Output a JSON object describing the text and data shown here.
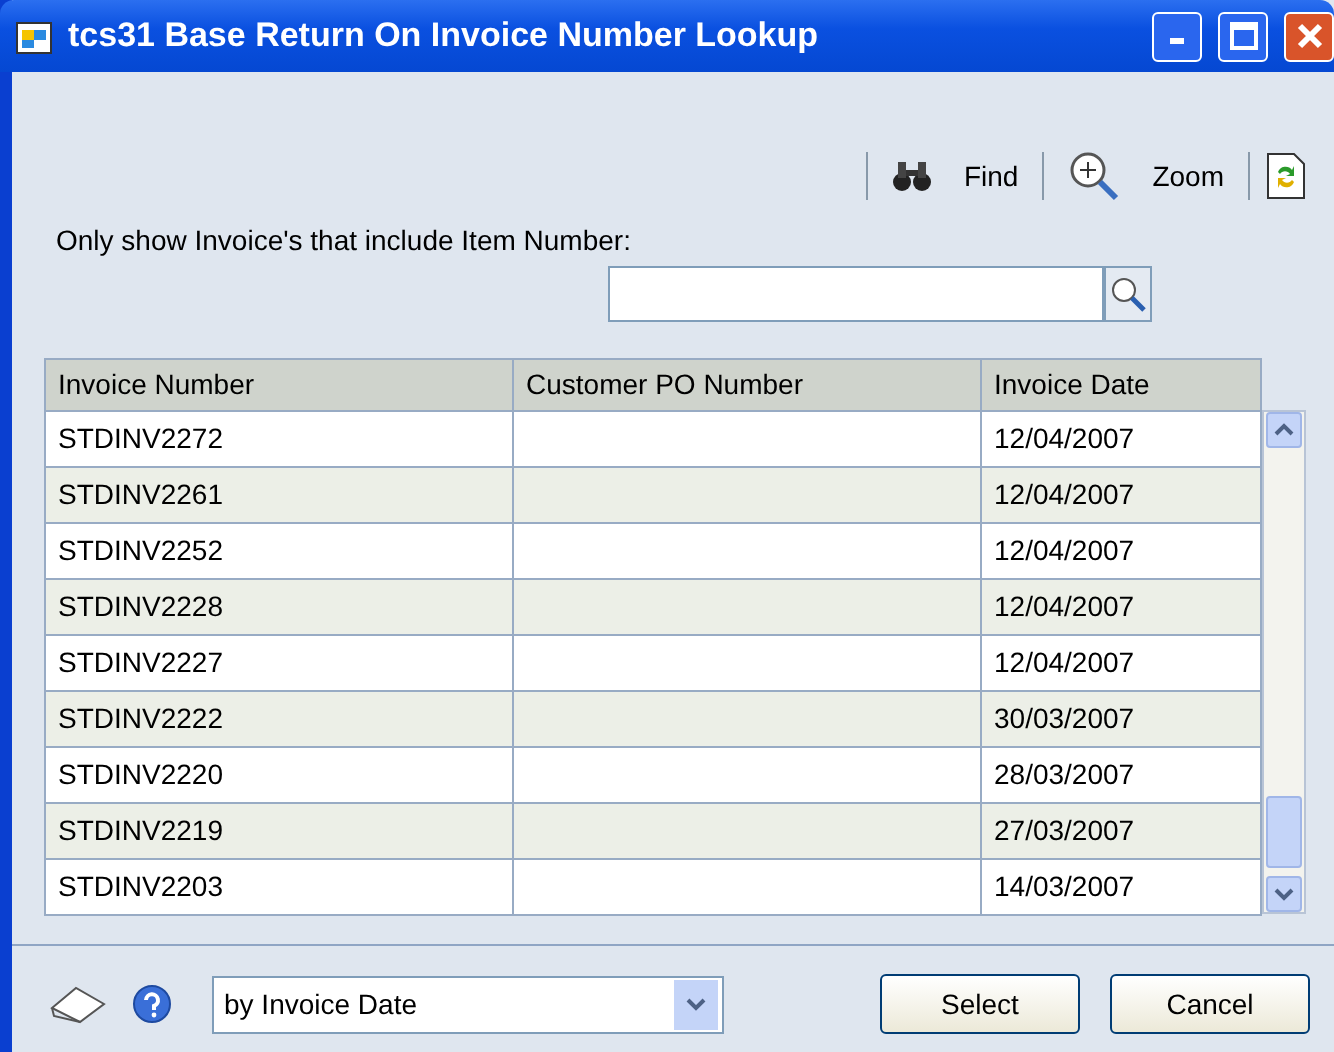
{
  "window": {
    "title": "tcs31 Base Return On Invoice Number Lookup"
  },
  "toolbar": [
    {
      "kind": "find",
      "label": "Find"
    },
    {
      "kind": "zoom",
      "label": "Zoom"
    },
    {
      "kind": "refresh"
    }
  ],
  "filter": {
    "label": "Only show Invoice's that include Item Number:"
  },
  "table": {
    "columns": [
      "Invoice Number",
      "Customer PO Number",
      "Invoice Date"
    ],
    "rows": [
      [
        "STDINV2272",
        "",
        "12/04/2007"
      ],
      [
        "STDINV2261",
        "",
        "12/04/2007"
      ],
      [
        "STDINV2252",
        "",
        "12/04/2007"
      ],
      [
        "STDINV2228",
        "",
        "12/04/2007"
      ],
      [
        "STDINV2227",
        "",
        "12/04/2007"
      ],
      [
        "STDINV2222",
        "",
        "30/03/2007"
      ],
      [
        "STDINV2220",
        "",
        "28/03/2007"
      ],
      [
        "STDINV2219",
        "",
        "27/03/2007"
      ],
      [
        "STDINV2203",
        "",
        "14/03/2007"
      ]
    ]
  },
  "sort": {
    "value": "by Invoice Date"
  },
  "buttons": [
    "Select",
    "Cancel"
  ]
}
